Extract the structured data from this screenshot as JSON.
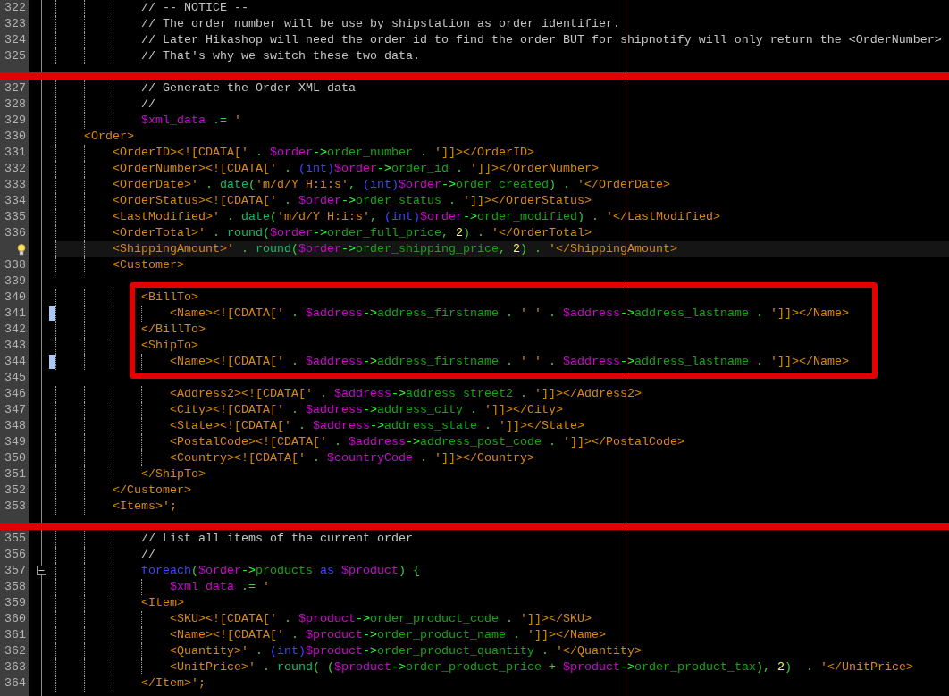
{
  "editor": {
    "lines": [
      {
        "kind": "code",
        "number": "322",
        "current": false,
        "tokens": [
          {
            "kind": "comment",
            "text": "            // -- NOTICE --"
          }
        ]
      },
      {
        "kind": "code",
        "number": "323",
        "current": false,
        "tokens": [
          {
            "kind": "comment",
            "text": "            // The order number will be use by shipstation as order identifier."
          }
        ]
      },
      {
        "kind": "code",
        "number": "324",
        "current": false,
        "tokens": [
          {
            "kind": "comment",
            "text": "            // Later Hikashop will need the order id to find the order BUT for shipnotify will only return the <OrderNumber>"
          }
        ]
      },
      {
        "kind": "code",
        "number": "325",
        "current": false,
        "tokens": [
          {
            "kind": "comment",
            "text": "            // That's why we switch these two data."
          }
        ]
      },
      {
        "kind": "cut"
      },
      {
        "kind": "code",
        "number": "327",
        "current": false,
        "tokens": [
          {
            "kind": "comment",
            "text": "            // Generate the Order XML data"
          }
        ]
      },
      {
        "kind": "code",
        "number": "328",
        "current": false,
        "tokens": [
          {
            "kind": "comment",
            "text": "            //"
          }
        ]
      },
      {
        "kind": "code",
        "number": "329",
        "current": false,
        "tokens": [
          {
            "kind": "var",
            "text": "            $xml_data"
          },
          {
            "kind": "op",
            "text": " .= "
          },
          {
            "kind": "tag",
            "text": "'"
          }
        ]
      },
      {
        "kind": "code",
        "number": "330",
        "current": false,
        "tokens": [
          {
            "kind": "tag",
            "text": "    <Order>"
          }
        ]
      },
      {
        "kind": "code",
        "number": "331",
        "current": false,
        "tokens": [
          {
            "kind": "tag",
            "text": "        <OrderID><![CDATA['"
          },
          {
            "kind": "op",
            "text": " . "
          },
          {
            "kind": "var",
            "text": "$order"
          },
          {
            "kind": "arrow",
            "text": "->"
          },
          {
            "kind": "prop",
            "text": "order_number"
          },
          {
            "kind": "op",
            "text": " . "
          },
          {
            "kind": "tag",
            "text": "']]></OrderID>"
          }
        ]
      },
      {
        "kind": "code",
        "number": "332",
        "current": false,
        "tokens": [
          {
            "kind": "tag",
            "text": "        <OrderNumber><![CDATA['"
          },
          {
            "kind": "op",
            "text": " . "
          },
          {
            "kind": "keyword",
            "text": "(int)"
          },
          {
            "kind": "var",
            "text": "$order"
          },
          {
            "kind": "arrow",
            "text": "->"
          },
          {
            "kind": "prop",
            "text": "order_id"
          },
          {
            "kind": "op",
            "text": " . "
          },
          {
            "kind": "tag",
            "text": "']]></OrderNumber>"
          }
        ]
      },
      {
        "kind": "code",
        "number": "333",
        "current": false,
        "tokens": [
          {
            "kind": "tag",
            "text": "        <OrderDate>'"
          },
          {
            "kind": "op",
            "text": " . "
          },
          {
            "kind": "func",
            "text": "date"
          },
          {
            "kind": "op",
            "text": "("
          },
          {
            "kind": "tag",
            "text": "'m/d/Y H:i:s'"
          },
          {
            "kind": "op",
            "text": ", "
          },
          {
            "kind": "keyword",
            "text": "(int)"
          },
          {
            "kind": "var",
            "text": "$order"
          },
          {
            "kind": "arrow",
            "text": "->"
          },
          {
            "kind": "prop",
            "text": "order_created"
          },
          {
            "kind": "op",
            "text": ") . "
          },
          {
            "kind": "tag",
            "text": "'</OrderDate>"
          }
        ]
      },
      {
        "kind": "code",
        "number": "334",
        "current": false,
        "tokens": [
          {
            "kind": "tag",
            "text": "        <OrderStatus><![CDATA['"
          },
          {
            "kind": "op",
            "text": " . "
          },
          {
            "kind": "var",
            "text": "$order"
          },
          {
            "kind": "arrow",
            "text": "->"
          },
          {
            "kind": "prop",
            "text": "order_status"
          },
          {
            "kind": "op",
            "text": " . "
          },
          {
            "kind": "tag",
            "text": "']]></OrderStatus>"
          }
        ]
      },
      {
        "kind": "code",
        "number": "335",
        "current": false,
        "tokens": [
          {
            "kind": "tag",
            "text": "        <LastModified>'"
          },
          {
            "kind": "op",
            "text": " . "
          },
          {
            "kind": "func",
            "text": "date"
          },
          {
            "kind": "op",
            "text": "("
          },
          {
            "kind": "tag",
            "text": "'m/d/Y H:i:s'"
          },
          {
            "kind": "op",
            "text": ", "
          },
          {
            "kind": "keyword",
            "text": "(int)"
          },
          {
            "kind": "var",
            "text": "$order"
          },
          {
            "kind": "arrow",
            "text": "->"
          },
          {
            "kind": "prop",
            "text": "order_modified"
          },
          {
            "kind": "op",
            "text": ") . "
          },
          {
            "kind": "tag",
            "text": "'</LastModified>"
          }
        ]
      },
      {
        "kind": "code",
        "number": "336",
        "current": false,
        "tokens": [
          {
            "kind": "tag",
            "text": "        <OrderTotal>'"
          },
          {
            "kind": "op",
            "text": " . "
          },
          {
            "kind": "func",
            "text": "round"
          },
          {
            "kind": "op",
            "text": "("
          },
          {
            "kind": "var",
            "text": "$order"
          },
          {
            "kind": "arrow",
            "text": "->"
          },
          {
            "kind": "prop",
            "text": "order_full_price"
          },
          {
            "kind": "op",
            "text": ", "
          },
          {
            "kind": "number",
            "text": "2"
          },
          {
            "kind": "op",
            "text": ") . "
          },
          {
            "kind": "tag",
            "text": "'</OrderTotal>"
          }
        ]
      },
      {
        "kind": "code",
        "current": true,
        "hint": true,
        "tokens": [
          {
            "kind": "tag",
            "text": "        <ShippingAmount>'"
          },
          {
            "kind": "op",
            "text": " . "
          },
          {
            "kind": "func",
            "text": "round"
          },
          {
            "kind": "op",
            "text": "("
          },
          {
            "kind": "var",
            "text": "$order"
          },
          {
            "kind": "arrow",
            "text": "->"
          },
          {
            "kind": "prop",
            "text": "order_shipping_price"
          },
          {
            "kind": "op",
            "text": ", "
          },
          {
            "kind": "number",
            "text": "2"
          },
          {
            "kind": "op",
            "text": ") . "
          },
          {
            "kind": "tag",
            "text": "'</ShippingAmount>"
          }
        ]
      },
      {
        "kind": "code",
        "number": "338",
        "current": false,
        "tokens": [
          {
            "kind": "tag",
            "text": "        <Customer>"
          }
        ]
      },
      {
        "kind": "code",
        "number": "339",
        "current": false
      },
      {
        "kind": "frame",
        "lines": [
          {
            "kind": "code",
            "number": "340",
            "current": false,
            "tokens": [
              {
                "kind": "tag",
                "text": "            <BillTo>"
              }
            ]
          },
          {
            "kind": "code",
            "number": "341",
            "current": false,
            "bookmarked": true,
            "tokens": [
              {
                "kind": "tag",
                "text": "                <Name><![CDATA['"
              },
              {
                "kind": "op",
                "text": " . "
              },
              {
                "kind": "var",
                "text": "$address"
              },
              {
                "kind": "arrow",
                "text": "->"
              },
              {
                "kind": "prop",
                "text": "address_firstname"
              },
              {
                "kind": "op",
                "text": " . "
              },
              {
                "kind": "tag",
                "text": "' '"
              },
              {
                "kind": "op",
                "text": " . "
              },
              {
                "kind": "var",
                "text": "$address"
              },
              {
                "kind": "arrow",
                "text": "->"
              },
              {
                "kind": "prop",
                "text": "address_lastname"
              },
              {
                "kind": "op",
                "text": " . "
              },
              {
                "kind": "tag",
                "text": "']]></Name>"
              }
            ]
          },
          {
            "kind": "code",
            "number": "342",
            "current": false,
            "tokens": [
              {
                "kind": "tag",
                "text": "            </BillTo>"
              }
            ]
          },
          {
            "kind": "code",
            "number": "343",
            "current": false,
            "tokens": [
              {
                "kind": "tag",
                "text": "            <ShipTo>"
              }
            ]
          },
          {
            "kind": "code",
            "number": "344",
            "current": false,
            "bookmarked": true,
            "tokens": [
              {
                "kind": "tag",
                "text": "                <Name><![CDATA['"
              },
              {
                "kind": "op",
                "text": " . "
              },
              {
                "kind": "var",
                "text": "$address"
              },
              {
                "kind": "arrow",
                "text": "->"
              },
              {
                "kind": "prop",
                "text": "address_firstname"
              },
              {
                "kind": "op",
                "text": " . "
              },
              {
                "kind": "tag",
                "text": "' '"
              },
              {
                "kind": "op",
                "text": " . "
              },
              {
                "kind": "var",
                "text": "$address"
              },
              {
                "kind": "arrow",
                "text": "->"
              },
              {
                "kind": "prop",
                "text": "address_lastname"
              },
              {
                "kind": "op",
                "text": " . "
              },
              {
                "kind": "tag",
                "text": "']]></Name>"
              }
            ]
          }
        ]
      },
      {
        "kind": "code",
        "number": "345",
        "current": false
      },
      {
        "kind": "code",
        "number": "346",
        "current": false,
        "tokens": [
          {
            "kind": "tag",
            "text": "                <Address2><![CDATA['"
          },
          {
            "kind": "op",
            "text": " . "
          },
          {
            "kind": "var",
            "text": "$address"
          },
          {
            "kind": "arrow",
            "text": "->"
          },
          {
            "kind": "prop",
            "text": "address_street2"
          },
          {
            "kind": "op",
            "text": " . "
          },
          {
            "kind": "tag",
            "text": "']]></Address2>"
          }
        ]
      },
      {
        "kind": "code",
        "number": "347",
        "current": false,
        "tokens": [
          {
            "kind": "tag",
            "text": "                <City><![CDATA['"
          },
          {
            "kind": "op",
            "text": " . "
          },
          {
            "kind": "var",
            "text": "$address"
          },
          {
            "kind": "arrow",
            "text": "->"
          },
          {
            "kind": "prop",
            "text": "address_city"
          },
          {
            "kind": "op",
            "text": " . "
          },
          {
            "kind": "tag",
            "text": "']]></City>"
          }
        ]
      },
      {
        "kind": "code",
        "number": "348",
        "current": false,
        "tokens": [
          {
            "kind": "tag",
            "text": "                <State><![CDATA['"
          },
          {
            "kind": "op",
            "text": " . "
          },
          {
            "kind": "var",
            "text": "$address"
          },
          {
            "kind": "arrow",
            "text": "->"
          },
          {
            "kind": "prop",
            "text": "address_state"
          },
          {
            "kind": "op",
            "text": " . "
          },
          {
            "kind": "tag",
            "text": "']]></State>"
          }
        ]
      },
      {
        "kind": "code",
        "number": "349",
        "current": false,
        "tokens": [
          {
            "kind": "tag",
            "text": "                <PostalCode><![CDATA['"
          },
          {
            "kind": "op",
            "text": " . "
          },
          {
            "kind": "var",
            "text": "$address"
          },
          {
            "kind": "arrow",
            "text": "->"
          },
          {
            "kind": "prop",
            "text": "address_post_code"
          },
          {
            "kind": "op",
            "text": " . "
          },
          {
            "kind": "tag",
            "text": "']]></PostalCode>"
          }
        ]
      },
      {
        "kind": "code",
        "number": "350",
        "current": false,
        "tokens": [
          {
            "kind": "tag",
            "text": "                <Country><![CDATA['"
          },
          {
            "kind": "op",
            "text": " . "
          },
          {
            "kind": "var",
            "text": "$countryCode"
          },
          {
            "kind": "op",
            "text": " . "
          },
          {
            "kind": "tag",
            "text": "']]></Country>"
          }
        ]
      },
      {
        "kind": "code",
        "number": "351",
        "current": false,
        "tokens": [
          {
            "kind": "tag",
            "text": "            </ShipTo>"
          }
        ]
      },
      {
        "kind": "code",
        "number": "352",
        "current": false,
        "tokens": [
          {
            "kind": "tag",
            "text": "        </Customer>"
          }
        ]
      },
      {
        "kind": "code",
        "number": "353",
        "current": false,
        "tokens": [
          {
            "kind": "tag",
            "text": "        <Items>';"
          }
        ]
      },
      {
        "kind": "cut"
      },
      {
        "kind": "code",
        "number": "355",
        "current": false,
        "tokens": [
          {
            "kind": "comment",
            "text": "            // List all items of the current order"
          }
        ]
      },
      {
        "kind": "code",
        "number": "356",
        "current": false,
        "tokens": [
          {
            "kind": "comment",
            "text": "            //"
          }
        ]
      },
      {
        "kind": "code",
        "number": "357",
        "current": false,
        "fold_expanded": true,
        "tokens": [
          {
            "kind": "keyword",
            "text": "            foreach"
          },
          {
            "kind": "op",
            "text": "("
          },
          {
            "kind": "var",
            "text": "$order"
          },
          {
            "kind": "arrow",
            "text": "->"
          },
          {
            "kind": "prop",
            "text": "products"
          },
          {
            "kind": "keyword",
            "text": " as "
          },
          {
            "kind": "var",
            "text": "$product"
          },
          {
            "kind": "op",
            "text": ") {"
          }
        ]
      },
      {
        "kind": "code",
        "number": "358",
        "current": false,
        "tokens": [
          {
            "kind": "var",
            "text": "                $xml_data"
          },
          {
            "kind": "op",
            "text": " .= "
          },
          {
            "kind": "tag",
            "text": "'"
          }
        ]
      },
      {
        "kind": "code",
        "number": "359",
        "current": false,
        "tokens": [
          {
            "kind": "tag",
            "text": "            <Item>"
          }
        ]
      },
      {
        "kind": "code",
        "number": "360",
        "current": false,
        "tokens": [
          {
            "kind": "tag",
            "text": "                <SKU><![CDATA['"
          },
          {
            "kind": "op",
            "text": " . "
          },
          {
            "kind": "var",
            "text": "$product"
          },
          {
            "kind": "arrow",
            "text": "->"
          },
          {
            "kind": "prop",
            "text": "order_product_code"
          },
          {
            "kind": "op",
            "text": " . "
          },
          {
            "kind": "tag",
            "text": "']]></SKU>"
          }
        ]
      },
      {
        "kind": "code",
        "number": "361",
        "current": false,
        "tokens": [
          {
            "kind": "tag",
            "text": "                <Name><![CDATA['"
          },
          {
            "kind": "op",
            "text": " . "
          },
          {
            "kind": "var",
            "text": "$product"
          },
          {
            "kind": "arrow",
            "text": "->"
          },
          {
            "kind": "prop",
            "text": "order_product_name"
          },
          {
            "kind": "op",
            "text": " . "
          },
          {
            "kind": "tag",
            "text": "']]></Name>"
          }
        ]
      },
      {
        "kind": "code",
        "number": "362",
        "current": false,
        "tokens": [
          {
            "kind": "tag",
            "text": "                <Quantity>'"
          },
          {
            "kind": "op",
            "text": " . "
          },
          {
            "kind": "keyword",
            "text": "(int)"
          },
          {
            "kind": "var",
            "text": "$product"
          },
          {
            "kind": "arrow",
            "text": "->"
          },
          {
            "kind": "prop",
            "text": "order_product_quantity"
          },
          {
            "kind": "op",
            "text": " . "
          },
          {
            "kind": "tag",
            "text": "'</Quantity>"
          }
        ]
      },
      {
        "kind": "code",
        "number": "363",
        "current": false,
        "tokens": [
          {
            "kind": "tag",
            "text": "                <UnitPrice>'"
          },
          {
            "kind": "op",
            "text": " . "
          },
          {
            "kind": "func",
            "text": "round"
          },
          {
            "kind": "op",
            "text": "( ("
          },
          {
            "kind": "var",
            "text": "$product"
          },
          {
            "kind": "arrow",
            "text": "->"
          },
          {
            "kind": "prop",
            "text": "order_product_price"
          },
          {
            "kind": "op",
            "text": " + "
          },
          {
            "kind": "var",
            "text": "$product"
          },
          {
            "kind": "arrow",
            "text": "->"
          },
          {
            "kind": "prop",
            "text": "order_product_tax"
          },
          {
            "kind": "op",
            "text": "), "
          },
          {
            "kind": "number",
            "text": "2"
          },
          {
            "kind": "op",
            "text": ")  . "
          },
          {
            "kind": "tag",
            "text": "'</UnitPrice>"
          }
        ]
      },
      {
        "kind": "code",
        "number": "364",
        "current": false,
        "tokens": [
          {
            "kind": "tag",
            "text": "            </Item>';"
          }
        ]
      }
    ]
  }
}
